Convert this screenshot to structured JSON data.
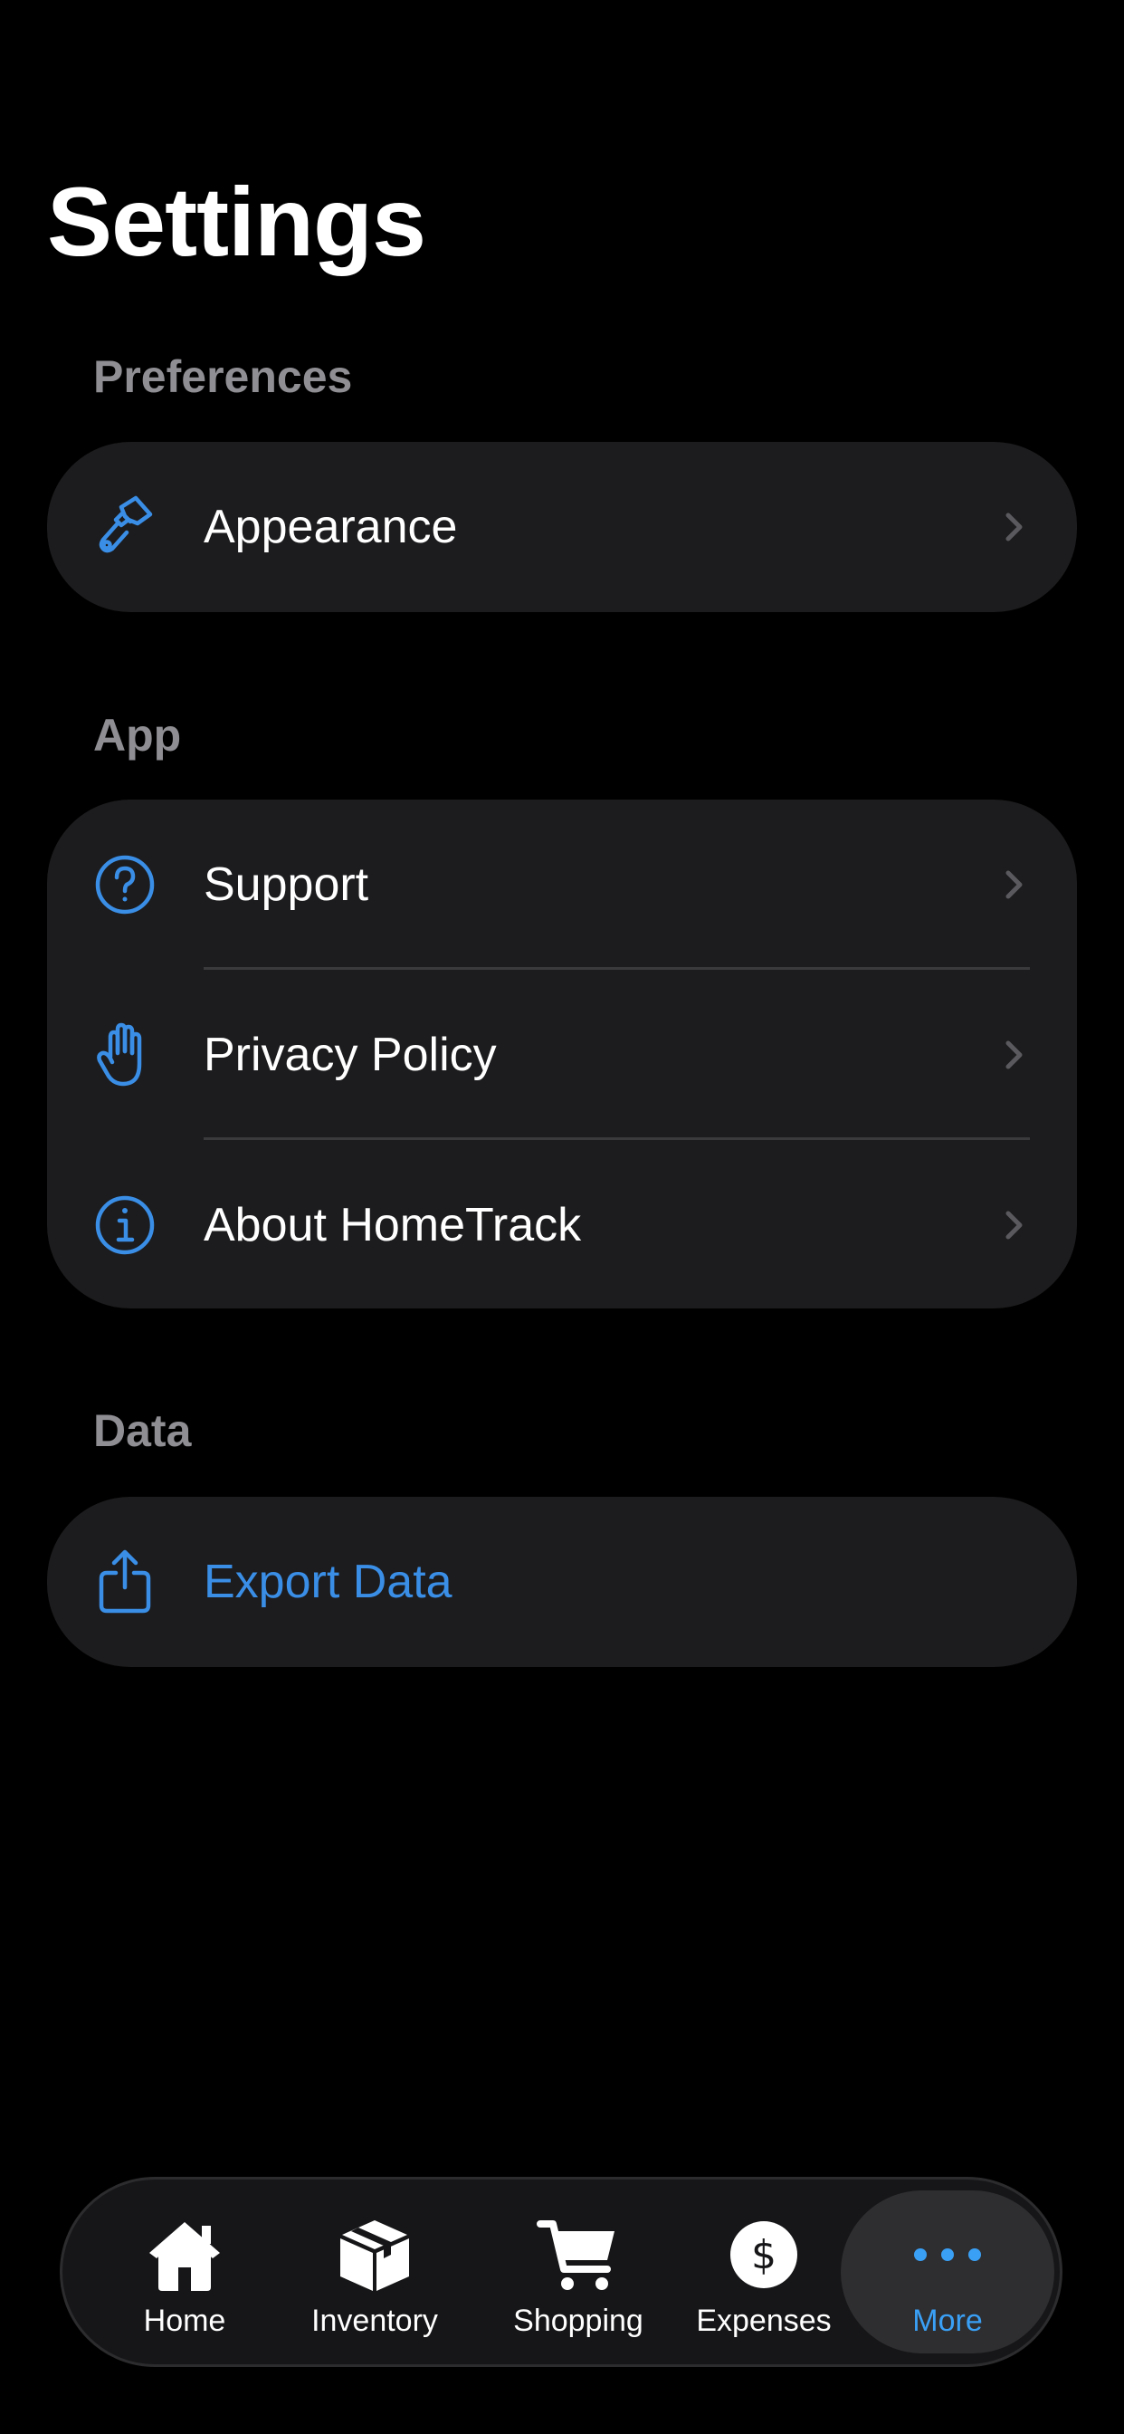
{
  "header": {
    "title": "Settings"
  },
  "sections": {
    "preferences": {
      "header": "Preferences",
      "items": [
        {
          "label": "Appearance",
          "icon": "paintbrush-icon"
        }
      ]
    },
    "app": {
      "header": "App",
      "items": [
        {
          "label": "Support",
          "icon": "question-circle-icon"
        },
        {
          "label": "Privacy Policy",
          "icon": "hand-raised-icon"
        },
        {
          "label": "About HomeTrack",
          "icon": "info-circle-icon"
        }
      ]
    },
    "data": {
      "header": "Data",
      "items": [
        {
          "label": "Export Data",
          "icon": "share-export-icon"
        }
      ]
    }
  },
  "tab_bar": {
    "tabs": [
      {
        "label": "Home",
        "icon": "house-icon"
      },
      {
        "label": "Inventory",
        "icon": "shipping-box-icon"
      },
      {
        "label": "Shopping",
        "icon": "cart-icon"
      },
      {
        "label": "Expenses",
        "icon": "dollar-circle-icon"
      },
      {
        "label": "More",
        "icon": "ellipsis-icon"
      }
    ],
    "active": "More"
  },
  "colors": {
    "background": "#000000",
    "group_background": "#1c1c1e",
    "accent": "#3a8ee6",
    "section_header": "#8e8e93",
    "separator": "#3a3a3c",
    "chevron": "#5a5a5e",
    "tab_active": "#3aa0f5"
  }
}
